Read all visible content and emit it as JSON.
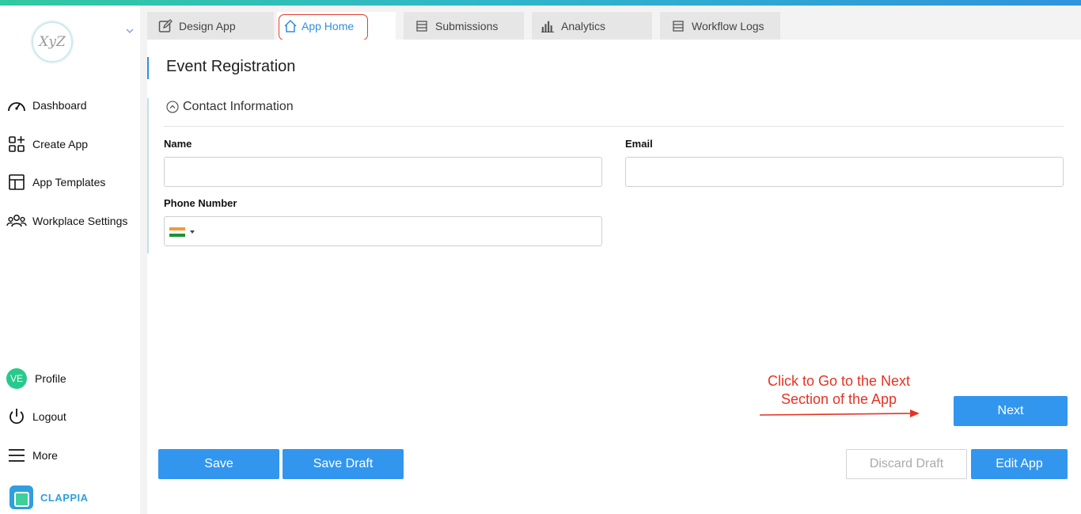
{
  "sidebar": {
    "logo_text": "XyZ",
    "items": [
      {
        "label": "Dashboard",
        "icon": "gauge-icon"
      },
      {
        "label": "Create App",
        "icon": "add-grid-icon"
      },
      {
        "label": "App Templates",
        "icon": "template-icon"
      },
      {
        "label": "Workplace Settings",
        "icon": "team-icon"
      }
    ],
    "bottom": [
      {
        "label": "Profile",
        "avatar": "VE"
      },
      {
        "label": "Logout",
        "icon": "power-icon"
      },
      {
        "label": "More",
        "icon": "menu-icon"
      }
    ],
    "brand": "CLAPPIA"
  },
  "tabs": [
    {
      "label": "Design App",
      "icon": "edit-icon"
    },
    {
      "label": "App Home",
      "icon": "home-icon",
      "active": true
    },
    {
      "label": "Submissions",
      "icon": "list-icon"
    },
    {
      "label": "Analytics",
      "icon": "bar-chart-icon"
    },
    {
      "label": "Workflow Logs",
      "icon": "list-icon"
    }
  ],
  "form": {
    "title": "Event Registration",
    "section": "Contact Information",
    "fields": {
      "name": {
        "label": "Name",
        "value": "",
        "placeholder": ""
      },
      "email": {
        "label": "Email",
        "value": "",
        "placeholder": ""
      },
      "phone": {
        "label": "Phone Number",
        "value": "",
        "placeholder": "",
        "country": "India"
      }
    }
  },
  "buttons": {
    "next": "Next",
    "save": "Save",
    "save_draft": "Save Draft",
    "discard_draft": "Discard Draft",
    "edit_app": "Edit App"
  },
  "annotation": {
    "line1": "Click to Go to the Next",
    "line2": "Section of the App"
  },
  "colors": {
    "accent": "#3296ef",
    "annotation": "#e63323",
    "avatar": "#28c98c",
    "brand": "#2f9fdd"
  }
}
